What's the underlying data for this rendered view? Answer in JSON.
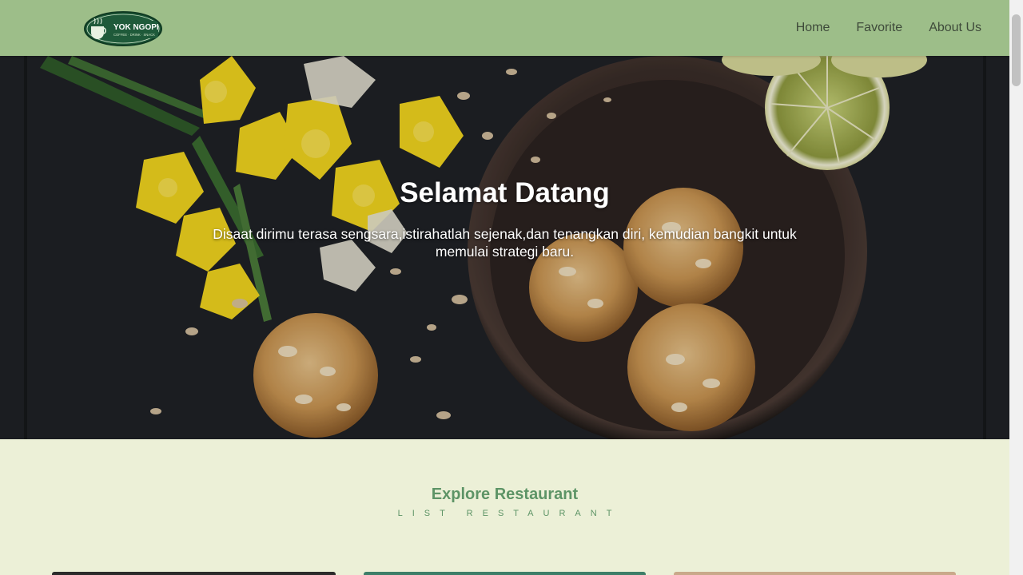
{
  "header": {
    "logo": {
      "name": "YOK NGOPI",
      "tagline": "COFFEE · DRINK · SNACK"
    },
    "nav": [
      {
        "label": "Home"
      },
      {
        "label": "Favorite"
      },
      {
        "label": "About Us"
      }
    ]
  },
  "hero": {
    "title": "Selamat Datang",
    "text": "Disaat dirimu terasa sengsara,istirahatlah sejenak,dan tenangkan diri, kemudian bangkit untuk memulai strategi baru."
  },
  "explore": {
    "title": "Explore Restaurant",
    "subtitle": "LIST RESTAURANT"
  },
  "colors": {
    "header_bg": "#9dbe89",
    "section_bg": "#ecf0d7",
    "accent_text": "#5d9466",
    "nav_text": "#3e4a3a"
  }
}
